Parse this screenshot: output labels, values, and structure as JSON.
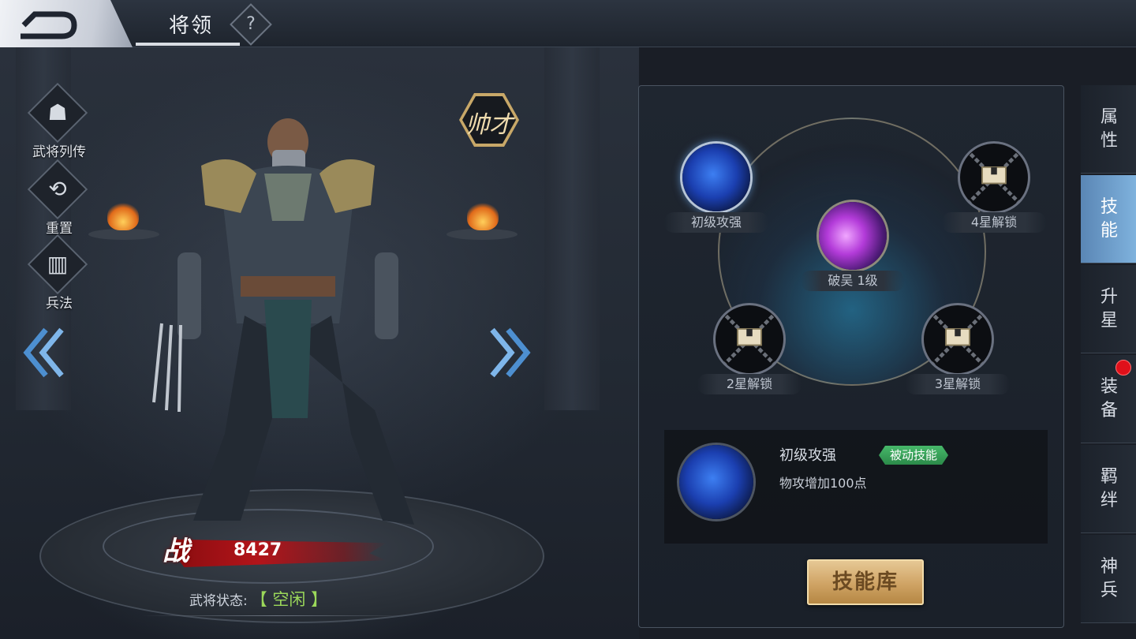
{
  "header": {
    "title": "将领",
    "help_label": "?"
  },
  "left_menu": [
    {
      "label": "武将列传",
      "icon": "helmet-icon",
      "glyph": "☗"
    },
    {
      "label": "重置",
      "icon": "reset-icon",
      "glyph": "⟲"
    },
    {
      "label": "兵法",
      "icon": "scroll-book-icon",
      "glyph": "▥"
    }
  ],
  "hero": {
    "talent_badge": "帅才",
    "power_label": "战",
    "power_value": "8427",
    "status_key": "武将状态:",
    "status_value": "【 空闲 】"
  },
  "skills": {
    "slots": [
      {
        "name": "初级攻强",
        "state": "unlocked",
        "icon": "fist-skill-icon"
      },
      {
        "name": "破吴 1级",
        "state": "unlocked",
        "icon": "purple-slash-skill-icon"
      },
      {
        "name": "4星解锁",
        "state": "locked",
        "icon": "chain-lock-icon"
      },
      {
        "name": "2星解锁",
        "state": "locked",
        "icon": "chain-lock-icon"
      },
      {
        "name": "3星解锁",
        "state": "locked",
        "icon": "chain-lock-icon"
      }
    ],
    "detail": {
      "title": "初级攻强",
      "tag": "被动技能",
      "description": "物攻增加100点"
    },
    "library_button": "技能库"
  },
  "tabs": [
    {
      "label": "属性",
      "active": false
    },
    {
      "label": "技能",
      "active": true
    },
    {
      "label": "升星",
      "active": false
    },
    {
      "label": "装备",
      "active": false,
      "notification": true
    },
    {
      "label": "羁绊",
      "active": false
    },
    {
      "label": "神兵",
      "active": false
    }
  ],
  "colors": {
    "active_tab": "#6e9ecb",
    "passive_tag": "#3aa75a",
    "notification_dot": "#e0101a",
    "status_value": "#9bd85a",
    "library_button": "#d4ab6c"
  }
}
